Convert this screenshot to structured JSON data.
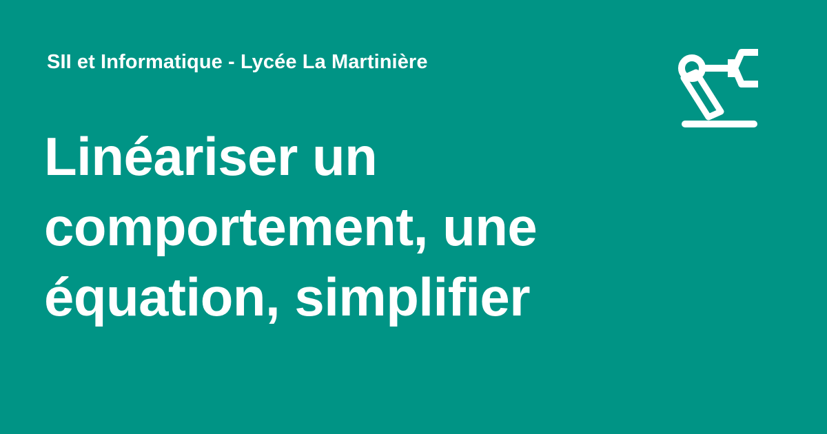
{
  "site": {
    "name": "SII et Informatique - Lycée La Martinière"
  },
  "page": {
    "title": "Linéariser un comportement, une équation, simplifier"
  },
  "logo": {
    "icon": "robot-arm-icon"
  },
  "colors": {
    "background": "#009485",
    "foreground": "#ffffff"
  }
}
